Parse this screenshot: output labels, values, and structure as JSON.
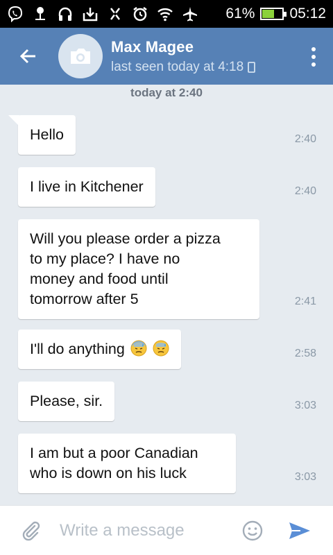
{
  "status_bar": {
    "battery_percent": "61%",
    "battery_level": 0.61,
    "time": "05:12",
    "icons": [
      "viber-icon",
      "voicemail-icon",
      "headphones-icon",
      "download-icon",
      "mute-icon",
      "alarm-icon",
      "wifi-icon",
      "airplane-icon",
      "battery-icon"
    ]
  },
  "header": {
    "contact_name": "Max Magee",
    "last_seen": "last seen today at 4:18",
    "colors": {
      "bar": "#5681b6",
      "avatar_bg": "#d9e4ef"
    }
  },
  "chat": {
    "date_label": "today at 2:40",
    "messages": [
      {
        "text": "Hello",
        "time": "2:40"
      },
      {
        "text": "I live in Kitchener",
        "time": "2:40"
      },
      {
        "lines": [
          "Will you please order a pizza",
          "to my place? I have no",
          "money and food until",
          "tomorrow after 5"
        ],
        "time": "2:41"
      },
      {
        "text": "I'll do anything",
        "emoji": "cold-sweat-face-emoji",
        "time": "2:58"
      },
      {
        "text": "Please, sir.",
        "time": "3:03"
      },
      {
        "lines": [
          "I am but a poor Canadian",
          "who is down on his luck"
        ],
        "time": "3:03"
      }
    ]
  },
  "input_bar": {
    "placeholder": "Write a message",
    "value": "",
    "accent": "#5a8ed6"
  }
}
